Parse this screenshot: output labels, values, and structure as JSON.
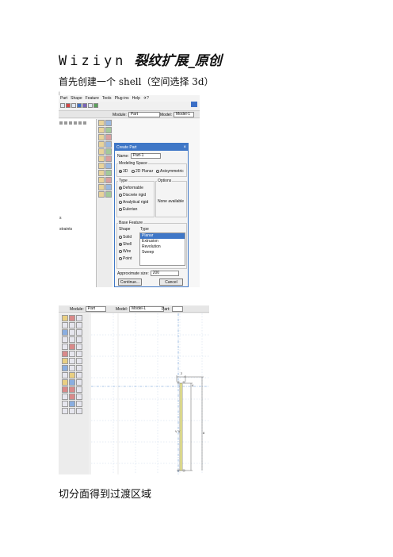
{
  "document": {
    "author": "Wiziyn",
    "headline": "裂纹扩展_原创",
    "intro": "首先创建一个 shell（空间选择 3d）",
    "stray_mark": "I",
    "caption": "切分面得到过渡区域"
  },
  "screenshot1": {
    "menu": [
      "Part",
      "Shape",
      "Feature",
      "Tools",
      "Plug-ins",
      "Help",
      "✈?"
    ],
    "module_label": "Module:",
    "module_value": "Part",
    "model_label": "Model:",
    "model_value": "Model-1",
    "tree_items": [
      "s",
      "straints"
    ],
    "dialog": {
      "title": "Create Part",
      "name_label": "Name:",
      "name_value": "Part-1",
      "modeling_space_label": "Modeling Space",
      "spaces": [
        "3D",
        "2D Planar",
        "Axisymmetric"
      ],
      "selected_space": "3D",
      "type_label": "Type",
      "types": [
        "Deformable",
        "Discrete rigid",
        "Analytical rigid",
        "Eulerian"
      ],
      "selected_type": "Deformable",
      "options_label": "Options",
      "options_value": "None available",
      "base_feature_label": "Base Feature",
      "shape_label": "Shape",
      "shapes": [
        "Solid",
        "Shell",
        "Wire",
        "Point"
      ],
      "selected_shape": "Shell",
      "feature_type_label": "Type",
      "feature_types": [
        "Planar",
        "Extrusion",
        "Revolution",
        "Sweep"
      ],
      "selected_feature_type": "Planar",
      "approx_size_label": "Approximate size:",
      "approx_size_value": "200",
      "continue_label": "Continue...",
      "cancel_label": "Cancel"
    }
  },
  "screenshot2": {
    "module_label": "Module:",
    "module_value": "Part",
    "model_label": "Model:",
    "model_value": "Model-1",
    "part_label": "Part:",
    "dim_labels": [
      "2",
      "4",
      "8"
    ],
    "vv_text": "V V"
  }
}
